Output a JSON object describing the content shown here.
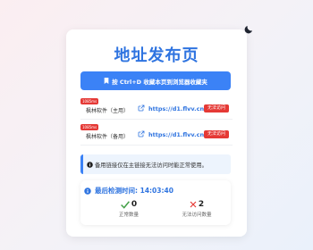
{
  "colors": {
    "accent": "#2f74e0",
    "button": "#3b82f6",
    "danger": "#e53935",
    "success": "#43a047"
  },
  "header": {
    "title": "地址发布页",
    "theme_toggle_icon": "moon-icon"
  },
  "bookmark": {
    "label": "按 Ctrl+D 收藏本页到浏览器收藏夹",
    "icon": "bookmark-icon"
  },
  "mirrors": [
    {
      "latency": "1085ms",
      "name": "枫林软件（主用）",
      "url": "https://d1.flvv.cn",
      "status": "无法访问"
    },
    {
      "latency": "1085ms",
      "name": "枫林软件（备用）",
      "url": "https://d1.flvv.cn",
      "status": "无法访问"
    }
  ],
  "notice": {
    "icon": "info-icon",
    "text": "备用链接仅在主链接无法访问时能正常使用。"
  },
  "check": {
    "label": "最后检测时间: 14:03:40",
    "ok_count": "0",
    "ok_label": "正常数量",
    "fail_count": "2",
    "fail_label": "无法访问数量"
  }
}
